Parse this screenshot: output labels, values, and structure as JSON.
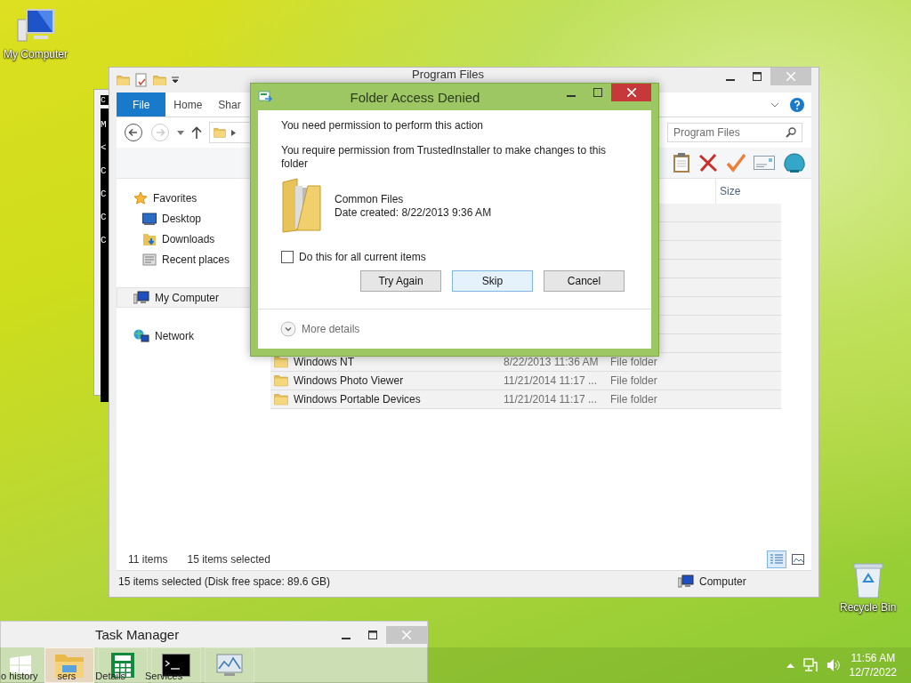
{
  "desktop_icons": [
    {
      "label": "My Computer",
      "kind": "computer"
    },
    {
      "label": "Recycle Bin",
      "kind": "recycle"
    }
  ],
  "console": {
    "title": "c",
    "lines": [
      "M",
      "<",
      "C",
      "C",
      "C",
      "C"
    ]
  },
  "explorer": {
    "title": "Program Files",
    "ribbon_tabs": [
      {
        "label": "File",
        "selected": true
      },
      {
        "label": "Home",
        "selected": false
      },
      {
        "label": "Shar",
        "selected": false
      }
    ],
    "search": {
      "placeholder": "Program Files"
    },
    "columns": [
      "Size"
    ],
    "nav": [
      {
        "label": "Favorites",
        "kind": "star",
        "selected": false,
        "children": [
          {
            "label": "Desktop",
            "kind": "desktop",
            "selected": false
          },
          {
            "label": "Downloads",
            "kind": "downloads",
            "selected": false
          },
          {
            "label": "Recent places",
            "kind": "recent",
            "selected": false
          }
        ]
      },
      {
        "label": "My Computer",
        "kind": "computer",
        "selected": true
      },
      {
        "label": "Network",
        "kind": "network",
        "selected": false
      }
    ],
    "files": [
      {
        "name": "Windows NT",
        "date": "8/22/2013 11:36 AM",
        "type": "File folder",
        "selected": true
      },
      {
        "name": "Windows Photo Viewer",
        "date": "11/21/2014 11:17 ...",
        "type": "File folder",
        "selected": true
      },
      {
        "name": "Windows Portable Devices",
        "date": "11/21/2014 11:17 ...",
        "type": "File folder",
        "selected": true
      }
    ],
    "item_count": "11 items",
    "selected_count": "15 items selected",
    "views": [
      {
        "kind": "details",
        "selected": true
      },
      {
        "kind": "tiles",
        "selected": false
      }
    ],
    "status_text": "15 items selected (Disk free space: 89.6 GB)",
    "status_location": "Computer"
  },
  "dialog": {
    "title": "Folder Access Denied",
    "heading": "You need permission to perform this action",
    "message": "You require permission from TrustedInstaller to make changes to this folder",
    "item": {
      "name": "Common Files",
      "date": "Date created: 8/22/2013 9:36 AM"
    },
    "checkbox": {
      "label": "Do this for all current items",
      "checked": false
    },
    "buttons": [
      {
        "label": "Try Again",
        "focused": false
      },
      {
        "label": "Skip",
        "focused": true
      },
      {
        "label": "Cancel",
        "focused": false
      }
    ],
    "more_details": "More details"
  },
  "task_manager": {
    "title": "Task Manager",
    "tabs": [
      "o history",
      "sers",
      "Details",
      "Services"
    ]
  },
  "taskbar": {
    "apps": [
      {
        "kind": "explorer",
        "active": true
      },
      {
        "kind": "calculator",
        "active": false
      },
      {
        "kind": "cmd",
        "active": false
      },
      {
        "kind": "monitor",
        "active": false
      }
    ],
    "time": "11:56 AM",
    "date": "12/7/2022"
  }
}
